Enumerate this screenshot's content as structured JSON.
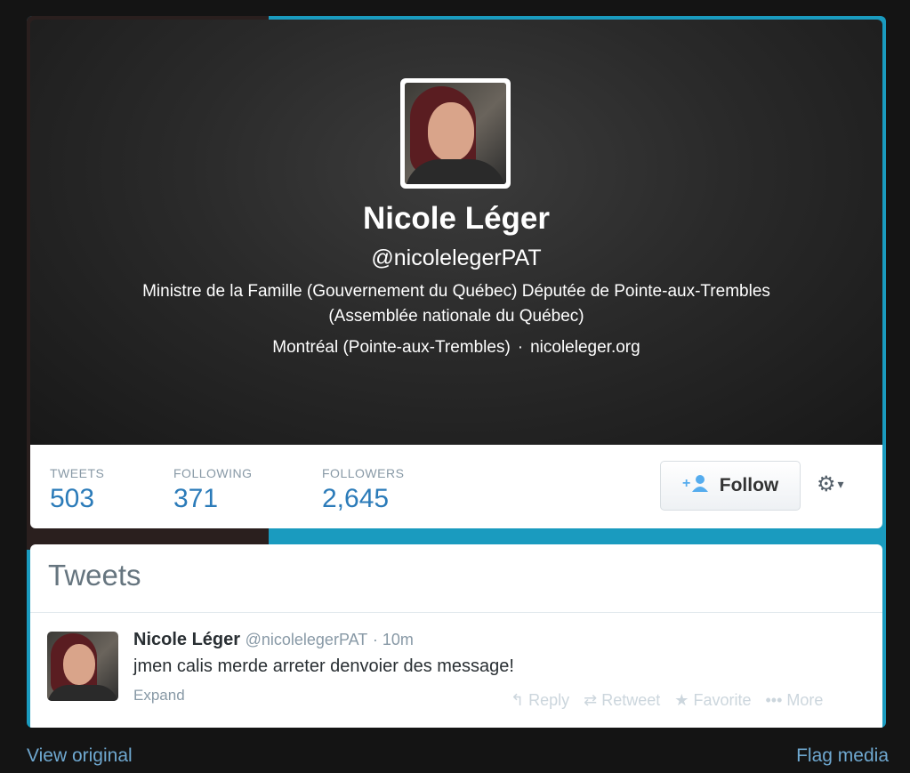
{
  "profile": {
    "name": "Nicole Léger",
    "handle": "@nicolelegerPAT",
    "bio": "Ministre de la Famille (Gouvernement du Québec) Députée de Pointe-aux-Trembles (Assemblée nationale du Québec)",
    "location": "Montréal (Pointe-aux-Trembles)",
    "separator": "·",
    "website": "nicoleleger.org"
  },
  "stats": [
    {
      "label": "TWEETS",
      "value": "503"
    },
    {
      "label": "FOLLOWING",
      "value": "371"
    },
    {
      "label": "FOLLOWERS",
      "value": "2,645"
    }
  ],
  "follow_button": {
    "label": "Follow",
    "icon": "add-user-icon"
  },
  "settings": {
    "icon": "gear-icon",
    "chevron": "▾"
  },
  "tweets_section": {
    "title": "Tweets",
    "tweet": {
      "author": "Nicole Léger",
      "handle": "@nicolelegerPAT",
      "time": "· 10m",
      "text": "jmen calis merde arreter denvoier des message!",
      "expand": "Expand",
      "actions": {
        "reply": "Reply",
        "retweet": "Retweet",
        "favorite": "Favorite",
        "more": "More"
      }
    }
  },
  "footer": {
    "view_original": "View original",
    "flag_media": "Flag media"
  },
  "colors": {
    "accent": "#1a9bbf",
    "stat_value": "#2b7bb9",
    "link": "#6fa8d0",
    "background": "#141414"
  }
}
